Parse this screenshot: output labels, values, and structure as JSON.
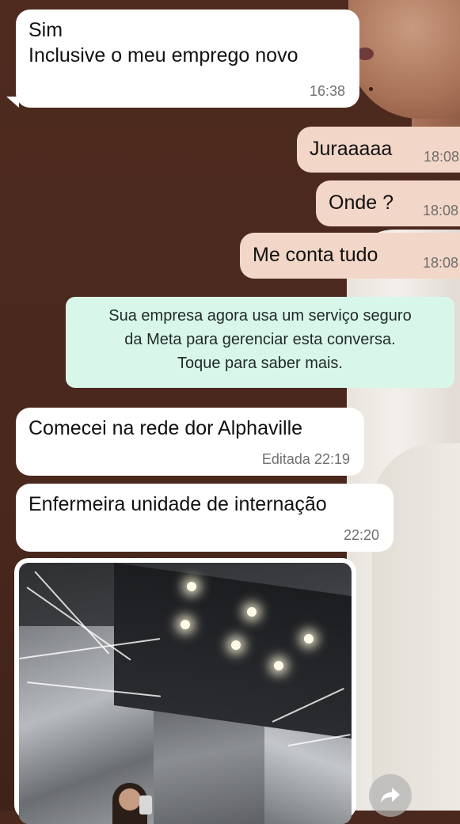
{
  "messages": [
    {
      "id": "m1",
      "direction": "incoming",
      "lines": [
        "Sim",
        "Inclusive o meu emprego novo"
      ],
      "time": "16:38"
    },
    {
      "id": "m2",
      "direction": "outgoing",
      "text": "Juraaaaa",
      "time": "18:08"
    },
    {
      "id": "m3",
      "direction": "outgoing",
      "text": "Onde ?",
      "time": "18:08"
    },
    {
      "id": "m4",
      "direction": "outgoing",
      "text": "Me conta tudo",
      "time": "18:08"
    },
    {
      "id": "m5",
      "direction": "incoming",
      "text": "Comecei na rede dor Alphaville",
      "edited_label": "Editada",
      "time": "22:19"
    },
    {
      "id": "m6",
      "direction": "incoming",
      "text": "Enfermeira unidade de internação",
      "time": "22:20"
    },
    {
      "id": "m7",
      "direction": "incoming",
      "type": "image",
      "subject": "elevator-mirror-selfie"
    }
  ],
  "system_notice": {
    "lines": [
      "Sua empresa agora usa um serviço seguro",
      "da Meta para gerenciar esta conversa.",
      "Toque para saber mais."
    ]
  },
  "icons": {
    "forward": "forward-arrow-icon"
  },
  "colors": {
    "incoming_bubble": "#ffffff",
    "outgoing_bubble": "#f2d6c7",
    "system_bubble": "#d9f6ea",
    "wallpaper": "#4a281d"
  }
}
